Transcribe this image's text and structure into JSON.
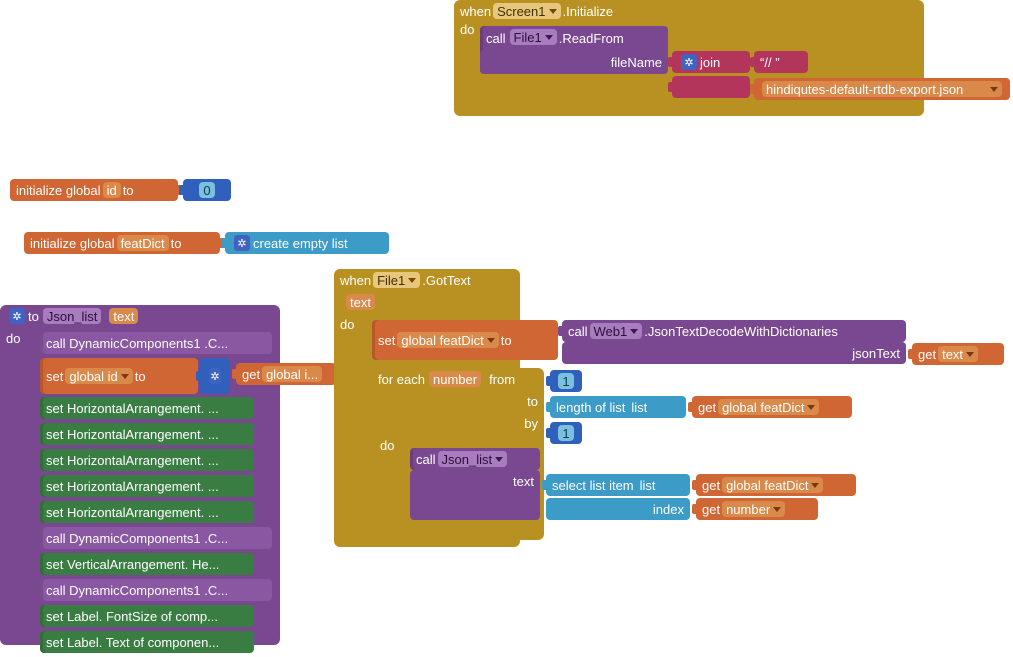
{
  "topEvent": {
    "when": "when",
    "component": "Screen1",
    "suffix": ".Initialize",
    "do": "do",
    "call": "call",
    "file": "File1",
    "readFrom": ".ReadFrom",
    "fileNameLabel": "fileName",
    "join": "join",
    "slashes": "//",
    "jsonFile": "hindiqutes-default-rtdb-export.json"
  },
  "initId": {
    "label": "initialize global",
    "var": "id",
    "to": "to",
    "value": "0"
  },
  "initFeat": {
    "label": "initialize global",
    "var": "featDict",
    "to": "to",
    "create": "create empty list"
  },
  "leftProc": {
    "gearTo": "to",
    "name": "Json_list",
    "param": "text",
    "do": "do",
    "callDyn1": "call  DynamicComponents1 .C...",
    "setGlobalId": "set",
    "setGlobalIdVar": "global id",
    "setGlobalIdTo": "to",
    "getGlobalId": "get",
    "getGlobalIdVar": "global i...",
    "rows": [
      "set HorizontalArrangement. ...",
      "set HorizontalArrangement. ...",
      "set HorizontalArrangement. ...",
      "set HorizontalArrangement. ...",
      "set HorizontalArrangement. ...",
      "call  DynamicComponents1 .C...",
      "set VerticalArrangement. He...",
      "call  DynamicComponents1 .C...",
      "set Label. FontSize of comp...",
      "set Label. Text of componen..."
    ]
  },
  "gotText": {
    "when": "when",
    "file": "File1",
    "suffix": ".GotText",
    "textParam": "text",
    "do": "do",
    "set": "set",
    "setVar": "global featDict",
    "to": "to",
    "call": "call",
    "web": "Web1",
    "method": ".JsonTextDecodeWithDictionaries",
    "jsonText": "jsonText",
    "get": "get",
    "textVar": "text",
    "forEach": "for each",
    "number": "number",
    "from": "from",
    "fromVal": "1",
    "toLbl": "to",
    "lengthOfList": "length of list",
    "list": "list",
    "featDict": "global featDict",
    "by": "by",
    "byVal": "1",
    "innerDo": "do",
    "innerCall": "call",
    "jsonList": "Json_list",
    "textLbl": "text",
    "selectItem": "select list item",
    "index": "index",
    "numberVar": "number"
  }
}
